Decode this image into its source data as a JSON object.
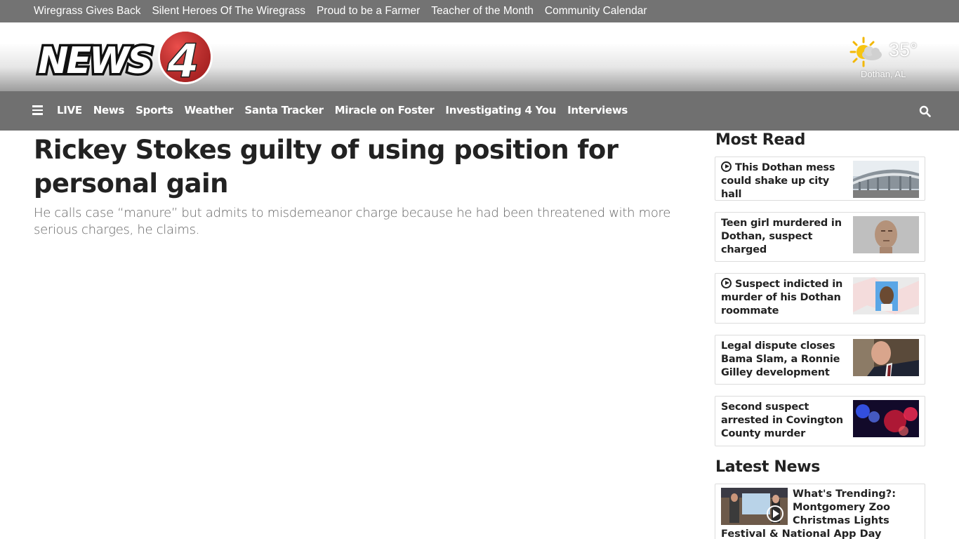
{
  "topbar": {
    "links": [
      "Wiregrass Gives Back",
      "Silent Heroes Of The Wiregrass",
      "Proud to be a Farmer",
      "Teacher of the Month",
      "Community Calendar"
    ]
  },
  "header": {
    "logo_text": "NEWS4",
    "weather": {
      "temp": "35°",
      "location": "Dothan, AL",
      "icon": "partly-sunny-icon"
    }
  },
  "nav": {
    "items": [
      "LIVE",
      "News",
      "Sports",
      "Weather",
      "Santa Tracker",
      "Miracle on Foster",
      "Investigating 4 You",
      "Interviews"
    ]
  },
  "article": {
    "headline": "Rickey Stokes guilty of using position for personal gain",
    "subhead": "He calls case “manure” but admits to misdemeanor charge because he had been threatened with more serious charges, he claims."
  },
  "sidebar": {
    "most_read_title": "Most Read",
    "most_read": [
      {
        "title": "This Dothan mess could shake up city hall",
        "video": true
      },
      {
        "title": "Teen girl murdered in Dothan, suspect charged",
        "video": false
      },
      {
        "title": "Suspect indicted in murder of his Dothan roommate",
        "video": true
      },
      {
        "title": "Legal dispute closes Bama Slam, a Ronnie Gilley development",
        "video": false
      },
      {
        "title": "Second suspect arrested in Covington County murder",
        "video": false
      }
    ],
    "latest_title": "Latest News",
    "latest": {
      "title_part1": "What's Trending?: Montgomery Zoo Christmas Lights",
      "title_part2": "Festival & National App Day"
    }
  },
  "colors": {
    "topbar": "#737373",
    "nav": "#707070",
    "logo_red": "#d32f2f",
    "text": "#222222"
  }
}
